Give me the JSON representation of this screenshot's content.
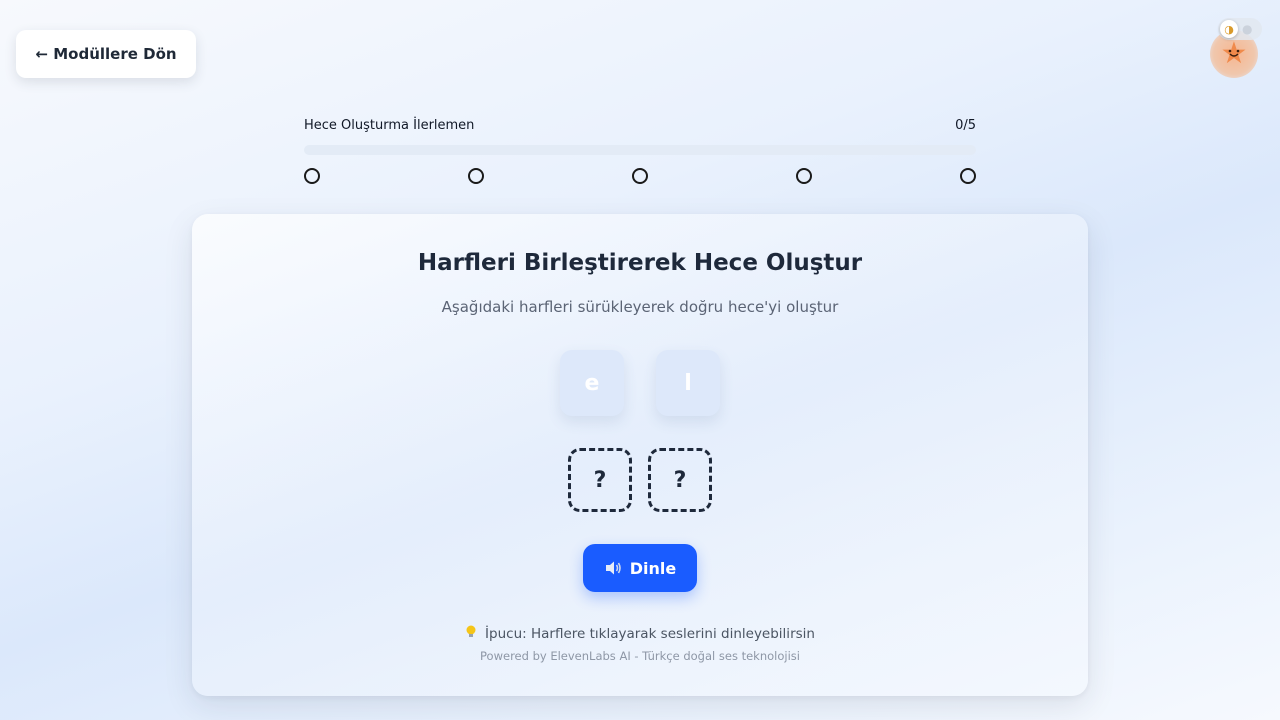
{
  "header": {
    "back_label": "← Modüllere Dön"
  },
  "progress": {
    "label": "Hece Oluşturma İlerlemen",
    "count_text": "0/5",
    "completed": 0,
    "total": 5
  },
  "card": {
    "title": "Harfleri Birleştirerek Hece Oluştur",
    "subtitle": "Aşağıdaki harfleri sürükleyerek doğru hece'yi oluştur",
    "letters": [
      "e",
      "l"
    ],
    "slots": [
      "?",
      "?"
    ],
    "listen_label": "Dinle",
    "hint": "İpucu: Harflere tıklayarak seslerini dinleyebilirsin",
    "powered_by": "Powered by ElevenLabs AI - Türkçe doğal ses teknolojisi"
  },
  "colors": {
    "accent": "#1a5cff",
    "text_dark": "#1e293b",
    "tile_bg": "#dde8fa"
  },
  "icons": {
    "back": "arrow-left-icon",
    "speaker": "speaker-icon",
    "hint": "lightbulb-icon",
    "mascot": "star-mascot-icon",
    "theme_sun": "sun-icon",
    "theme_moon": "moon-icon"
  }
}
